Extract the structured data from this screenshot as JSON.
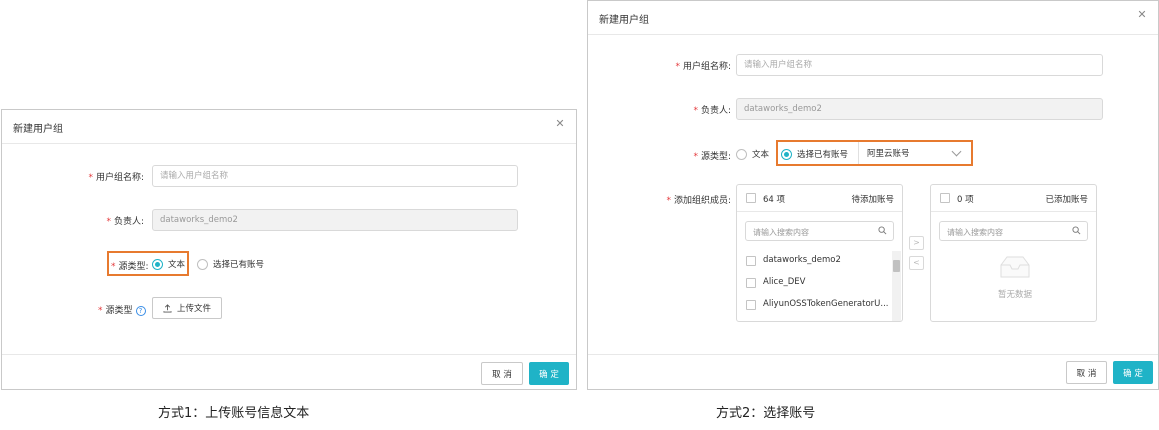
{
  "dialog1": {
    "title": "新建用户组",
    "group_name_label": "用户组名称:",
    "group_name_placeholder": "请输入用户组名称",
    "owner_label": "负责人:",
    "owner_value": "dataworks_demo2",
    "source_type_label": "源类型:",
    "radio_text": "文本",
    "radio_existing": "选择已有账号",
    "selected_option": "文本",
    "source_type_label_2": "源类型",
    "upload_button": "上传文件",
    "cancel_button": "取 消",
    "ok_button": "确 定"
  },
  "dialog2": {
    "title": "新建用户组",
    "group_name_label": "用户组名称:",
    "group_name_placeholder": "请输入用户组名称",
    "owner_label": "负责人:",
    "owner_value": "dataworks_demo2",
    "source_type_label": "源类型:",
    "radio_text": "文本",
    "radio_existing": "选择已有账号",
    "selected_option": "选择已有账号",
    "account_type_select": "阿里云账号",
    "members_label": "添加组织成员:",
    "left_panel": {
      "count": "64 项",
      "caption": "待添加账号",
      "search_placeholder": "请输入搜索内容",
      "items": [
        "dataworks_demo2",
        "Alice_DEV",
        "AliyunOSSTokenGeneratorU..."
      ]
    },
    "right_panel": {
      "count": "0 项",
      "caption": "已添加账号",
      "search_placeholder": "请输入搜索内容",
      "empty_text": "暂无数据"
    },
    "move_right": ">",
    "move_left": "<",
    "cancel_button": "取 消",
    "ok_button": "确 定"
  },
  "captions": {
    "method1": "方式1：上传账号信息文本",
    "method2": "方式2：选择账号"
  },
  "colors": {
    "primary": "#1fb3c7",
    "highlight": "#e77a2f",
    "required": "#e4393c"
  },
  "icons": {
    "close": "close-icon",
    "upload": "upload-icon",
    "help": "help-icon",
    "search": "search-icon",
    "empty": "empty-box-icon",
    "chevron": "chevron-down-icon"
  }
}
